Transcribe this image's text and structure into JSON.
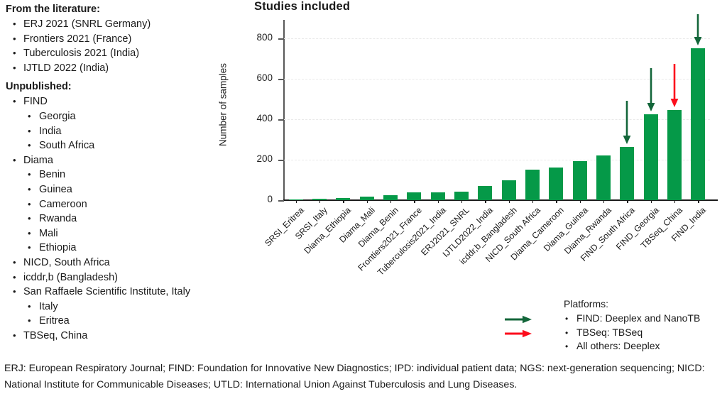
{
  "left_panel": {
    "literature_heading": "From the literature:",
    "literature_items": [
      "ERJ 2021 (SNRL Germany)",
      "Frontiers 2021 (France)",
      "Tuberculosis 2021 (India)",
      "IJTLD 2022 (India)"
    ],
    "unpublished_heading": "Unpublished:",
    "unpublished_items": [
      {
        "label": "FIND",
        "children": [
          "Georgia",
          "India",
          "South Africa"
        ]
      },
      {
        "label": "Diama",
        "children": [
          "Benin",
          "Guinea",
          "Cameroon",
          "Rwanda",
          "Mali",
          "Ethiopia"
        ]
      },
      {
        "label": "NICD, South Africa",
        "children": []
      },
      {
        "label": "icddr,b (Bangladesh)",
        "children": []
      },
      {
        "label": "San Raffaele Scientific Institute, Italy",
        "children": [
          "Italy",
          "Eritrea"
        ]
      },
      {
        "label": "TBSeq, China",
        "children": []
      }
    ],
    "bullet_glyph": "•"
  },
  "chart_data": {
    "type": "bar",
    "title": "Studies included",
    "xlabel": "",
    "ylabel": "Number of samples",
    "ylim": [
      0,
      840
    ],
    "yticks": [
      0,
      200,
      400,
      600,
      800
    ],
    "ytick_labels": [
      "0",
      "200",
      "400",
      "600",
      "800"
    ],
    "grid": true,
    "legend_position": "bottom-right",
    "bar_color": "#059948",
    "categories": [
      "SRSI_Eritrea",
      "SRSI_Italy",
      "Diama_Ethiopia",
      "Diama_Mali",
      "Diama_Benin",
      "Frontiers2021_France",
      "Tuberculosis2021_India",
      "ERJ2021_SNRL",
      "IJTLD2022_India",
      "icddr,b_Bangladesh",
      "NICD_South Africa",
      "Diama_Cameroon",
      "Diama_Guinea",
      "Diama_Rwanda",
      "FIND_South Africa",
      "FIND_Georgia",
      "TBSeq_China",
      "FIND_India"
    ],
    "values": [
      3,
      6,
      12,
      16,
      26,
      38,
      38,
      42,
      72,
      100,
      150,
      163,
      195,
      220,
      265,
      425,
      448,
      752
    ],
    "annotations": [
      {
        "category": "FIND_South Africa",
        "marker": "down-arrow",
        "color": "#13663a"
      },
      {
        "category": "FIND_Georgia",
        "marker": "down-arrow",
        "color": "#13663a"
      },
      {
        "category": "TBSeq_China",
        "marker": "down-arrow",
        "color": "#fc0d1c"
      },
      {
        "category": "FIND_India",
        "marker": "down-arrow",
        "color": "#13663a"
      }
    ]
  },
  "legend": {
    "title": "Platforms:",
    "items": [
      {
        "text": "FIND: Deeplex and NanoTB",
        "arrow_color": "#13663a"
      },
      {
        "text": "TBSeq: TBSeq",
        "arrow_color": "#fc0d1c"
      },
      {
        "text": "All others: Deeplex",
        "arrow_color": null
      }
    ],
    "bullet_glyph": "•"
  },
  "footer": {
    "text": "ERJ: European Respiratory Journal; FIND: Foundation for Innovative New Diagnostics; IPD: individual patient data; NGS: next-generation sequencing; NICD: National Institute for Communicable Diseases; UTLD: International Union Against Tuberculosis and Lung Diseases."
  }
}
